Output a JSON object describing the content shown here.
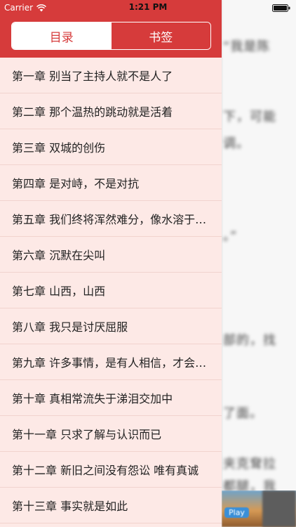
{
  "status_bar": {
    "carrier": "Carrier",
    "time": "1:21 PM"
  },
  "tabs": {
    "contents": "目录",
    "bookmarks": "书签"
  },
  "chapters": [
    "第一章 别当了主持人就不是人了",
    "第二章 那个温热的跳动就是活着",
    "第三章 双城的创伤",
    "第四章 是对峙，不是对抗",
    "第五章 我们终将浑然难分，像水溶于水中",
    "第六章 沉默在尖叫",
    "第七章 山西，山西",
    "第八章 我只是讨厌屈服",
    "第九章 许多事情，是有人相信，才会存在",
    "第十章 真相常流失于涕泪交加中",
    "第十一章 只求了解与认识而已",
    "第十二章 新旧之间没有怨讼 唯有真诚",
    "第十三章 事实就是如此"
  ],
  "reader_background": {
    "lines": [
      "“我是陈",
      "下，可能",
      "调。",
      "。”",
      "部的，找",
      "了面。",
      "夹克耷拉",
      "都腿，我"
    ]
  },
  "ad": {
    "label": "Play"
  },
  "colors": {
    "header_red": "#d63b3b",
    "drawer_bg": "#fde9e6",
    "divider": "#f1d3ce"
  }
}
